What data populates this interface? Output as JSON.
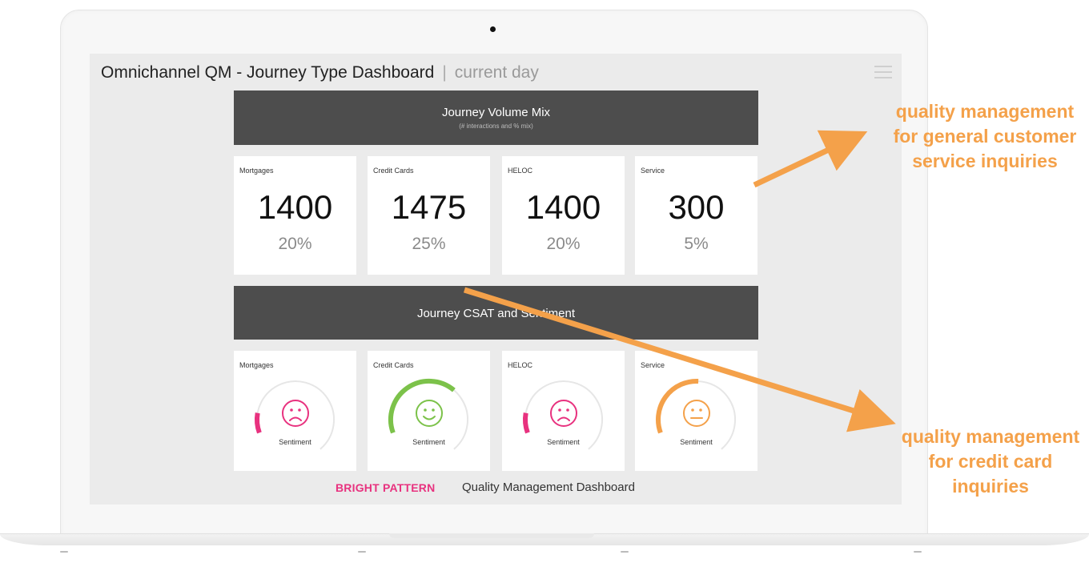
{
  "header": {
    "title": "Omnichannel QM - Journey Type Dashboard",
    "separator": "|",
    "subtitle": "current day"
  },
  "volume": {
    "title": "Journey Volume Mix",
    "subtitle": "(# interactions and % mix)",
    "cards": [
      {
        "label": "Mortgages",
        "value": "1400",
        "pct": "20%"
      },
      {
        "label": "Credit Cards",
        "value": "1475",
        "pct": "25%"
      },
      {
        "label": "HELOC",
        "value": "1400",
        "pct": "20%"
      },
      {
        "label": "Service",
        "value": "300",
        "pct": "5%"
      }
    ]
  },
  "sentiment": {
    "title": "Journey CSAT and Sentiment",
    "cards": [
      {
        "label": "Mortgages",
        "caption": "Sentiment",
        "level": 0.12,
        "mood": "sad",
        "color": "#e8327f"
      },
      {
        "label": "Credit Cards",
        "caption": "Sentiment",
        "level": 0.6,
        "mood": "happy",
        "color": "#7cc24a"
      },
      {
        "label": "HELOC",
        "caption": "Sentiment",
        "level": 0.12,
        "mood": "sad",
        "color": "#e8327f"
      },
      {
        "label": "Service",
        "caption": "Sentiment",
        "level": 0.45,
        "mood": "neutral",
        "color": "#f4a14a"
      }
    ]
  },
  "footer": {
    "brand": "BRIGHT PATTERN",
    "text": "Quality Management Dashboard"
  },
  "callouts": {
    "top": "quality management for general customer service inquiries",
    "bottom": "quality management for credit card inquiries"
  },
  "colors": {
    "accent": "#f4a14a",
    "brand": "#e8327f",
    "positive": "#7cc24a"
  },
  "icons": {
    "menu": "hamburger-icon",
    "sad": "sad-face-icon",
    "happy": "happy-face-icon",
    "neutral": "neutral-face-icon"
  }
}
